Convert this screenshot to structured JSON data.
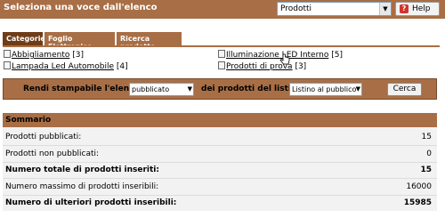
{
  "header": {
    "title": "Seleziona una voce dall'elenco",
    "product_select": "Prodotti",
    "help_label": "Help"
  },
  "tabs": [
    {
      "label": "Categorie",
      "active": true
    },
    {
      "label": "Foglio Elettronico",
      "active": false
    },
    {
      "label": "Ricerca prodotto",
      "active": false
    }
  ],
  "categories": [
    {
      "name": "Abbigliamento",
      "count": "[3]"
    },
    {
      "name": "Illuminazione LED Interno",
      "count": "[5]"
    },
    {
      "name": "Lampada Led Automobile",
      "count": "[4]"
    },
    {
      "name": "Prodotti di prova",
      "count": "[3]"
    }
  ],
  "listing": {
    "prefix": "Rendi stampabile l'elenco",
    "status_value": "pubblicato",
    "middle": "dei prodotti del listino",
    "listino_value": "Listino al pubblico",
    "search_label": "Cerca"
  },
  "summary": {
    "title": "Sommario",
    "rows": [
      {
        "label": "Prodotti pubblicati:",
        "value": "15",
        "bold": false
      },
      {
        "label": "Prodotti non pubblicati:",
        "value": "0",
        "bold": false
      },
      {
        "label": "Numero totale di prodotti inseriti:",
        "value": "15",
        "bold": true
      },
      {
        "label": "Numero massimo di prodotti inseribili:",
        "value": "16000",
        "bold": false
      },
      {
        "label": "Numero di ulteriori prodotti inseribili:",
        "value": "15985",
        "bold": true
      }
    ]
  },
  "colors": {
    "brand": "#a86e45",
    "active_tab": "#6e3d18",
    "summary_bg": "#f2f2f2"
  }
}
